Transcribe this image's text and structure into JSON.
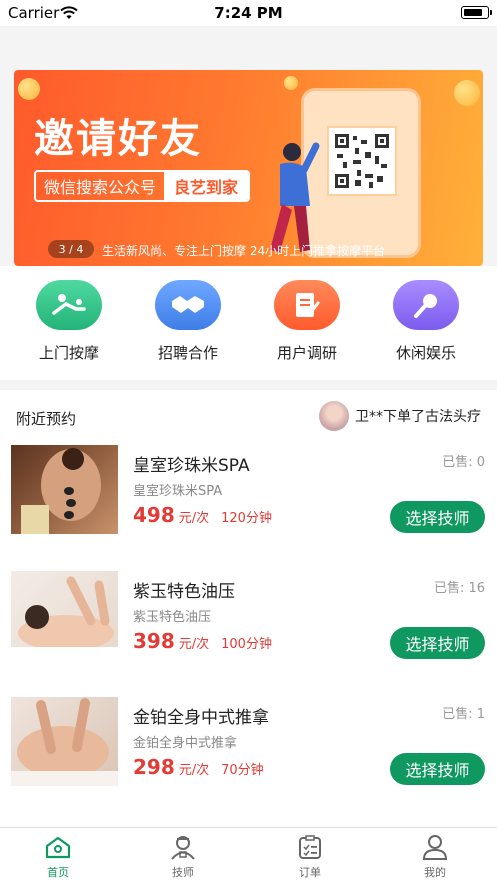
{
  "status_bar": {
    "carrier": "Carrier",
    "time": "7:24 PM"
  },
  "banner": {
    "title": "邀请好友",
    "search_text": "微信搜索公众号",
    "brand": "良艺到家",
    "pager": "3 / 4",
    "caption": "生活新风尚、专注上门按摩 24小时上门推拿按摩平台"
  },
  "quick_menu": [
    {
      "label": "上门按摩",
      "icon": "massage-icon",
      "color": "#2fc488"
    },
    {
      "label": "招聘合作",
      "icon": "handshake-icon",
      "color": "#4f8ff5"
    },
    {
      "label": "用户调研",
      "icon": "survey-icon",
      "color": "#ff6a3d"
    },
    {
      "label": "休闲娱乐",
      "icon": "microphone-icon",
      "color": "#8b6ef2"
    }
  ],
  "nearby": {
    "title": "附近预约",
    "notice": "卫**下单了古法头疗"
  },
  "services": [
    {
      "name": "皇室珍珠米SPA",
      "sub": "皇室珍珠米SPA",
      "price": "498",
      "unit": "元/次",
      "duration": "120分钟",
      "sold": "已售: 0",
      "button": "选择技师"
    },
    {
      "name": "紫玉特色油压",
      "sub": "紫玉特色油压",
      "price": "398",
      "unit": "元/次",
      "duration": "100分钟",
      "sold": "已售: 16",
      "button": "选择技师"
    },
    {
      "name": "金铂全身中式推拿",
      "sub": "金铂全身中式推拿",
      "price": "298",
      "unit": "元/次",
      "duration": "70分钟",
      "sold": "已售: 1",
      "button": "选择技师"
    }
  ],
  "tabbar": [
    {
      "label": "首页",
      "icon": "home-icon",
      "active": true
    },
    {
      "label": "技师",
      "icon": "technician-icon",
      "active": false
    },
    {
      "label": "订单",
      "icon": "order-icon",
      "active": false
    },
    {
      "label": "我的",
      "icon": "profile-icon",
      "active": false
    }
  ],
  "colors": {
    "accent": "#0f9960",
    "price": "#e43a35",
    "banner": "#ff6a2f"
  }
}
